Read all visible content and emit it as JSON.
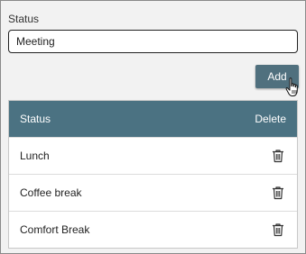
{
  "form": {
    "label": "Status",
    "input_value": "Meeting",
    "add_label": "Add"
  },
  "table": {
    "headers": {
      "status": "Status",
      "delete": "Delete"
    },
    "rows": [
      {
        "status": "Lunch",
        "delete_icon": "trash-icon"
      },
      {
        "status": "Coffee break",
        "delete_icon": "trash-icon"
      },
      {
        "status": "Comfort Break",
        "delete_icon": "trash-icon"
      }
    ]
  },
  "colors": {
    "header_bg": "#4b7282",
    "button_bg": "#50707e",
    "panel_bg": "#f2f2f2"
  }
}
